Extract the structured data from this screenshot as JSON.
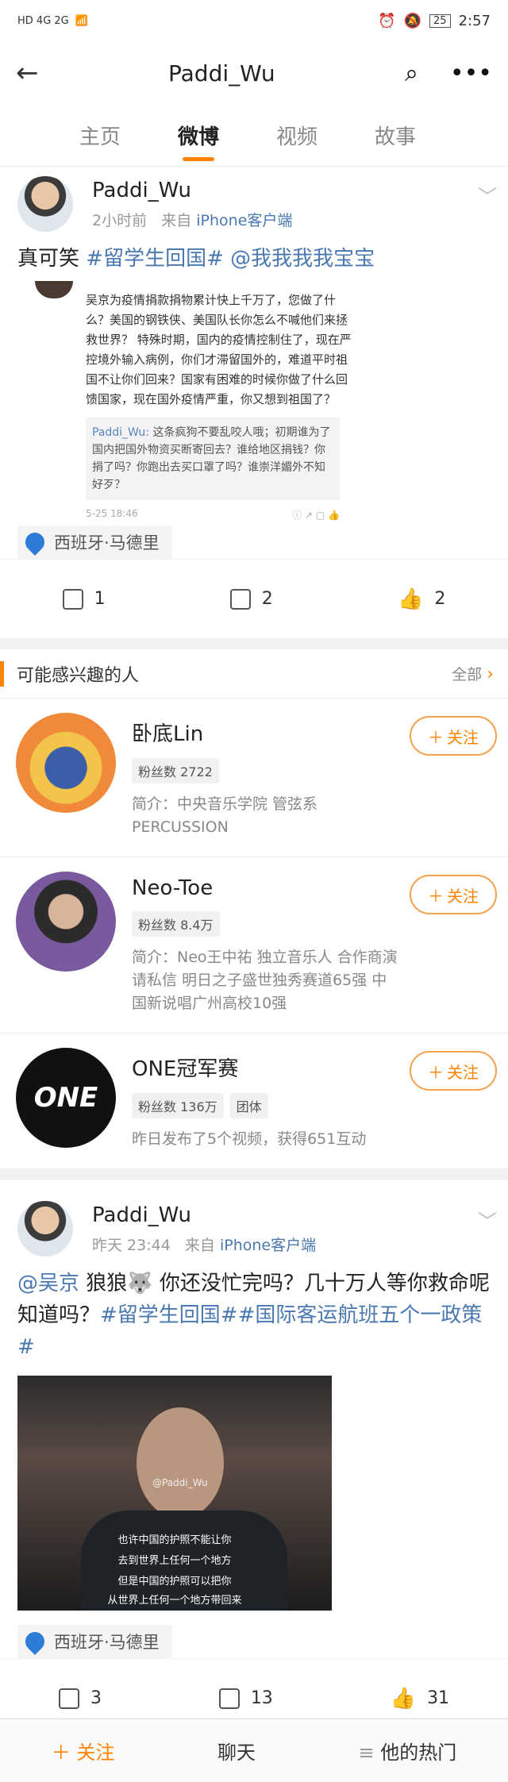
{
  "status": {
    "network": "HD 4G 2G",
    "time": "2:57",
    "battery": "25"
  },
  "topbar": {
    "title": "Paddi_Wu"
  },
  "tabs": [
    "主页",
    "微博",
    "视频",
    "故事"
  ],
  "active_tab": "微博",
  "post1": {
    "author": "Paddi_Wu",
    "time": "2小时前",
    "source_prefix": "来自",
    "source": "iPhone客户端",
    "text_plain": "真可笑",
    "text_tag": "#留学生回国#",
    "text_mention": "@我我我我宝宝",
    "quote_text": "吴京为疫情捐款捐物累计快上千万了，您做了什么？美国的钢铁侠、美国队长你怎么不喊他们来拯救世界？ 特殊时期，国内的疫情控制住了，现在严控境外输入病例，你们才滞留国外的，难道平时祖国不让你们回来？国家有困难的时候你做了什么回馈国家，现在国外疫情严重，你又想到祖国了？",
    "reply_name": "Paddi_Wu:",
    "reply_text": "这条疯狗不要乱咬人哦；初期谁为了国内把国外物资买断寄回去？谁给地区捐钱？你捐了吗？你跑出去买口罩了吗？谁崇洋媚外不知好歹？",
    "quote_date": "5-25 18:46",
    "location": "西班牙·马德里",
    "reposts": "1",
    "comments": "2",
    "likes": "2"
  },
  "suggest": {
    "title": "可能感兴趣的人",
    "all_label": "全部",
    "follow_label": "关注",
    "people": [
      {
        "name": "卧底Lin",
        "fans": "粉丝数 2722",
        "extra_tag": "",
        "desc": "简介：中央音乐学院 管弦系 PERCUSSION"
      },
      {
        "name": "Neo-Toe",
        "fans": "粉丝数 8.4万",
        "extra_tag": "",
        "desc": "简介：Neo王中祐 独立音乐人 合作商演请私信 明日之子盛世独秀赛道65强 中国新说唱广州高校10强"
      },
      {
        "name": "ONE冠军赛",
        "fans": "粉丝数 136万",
        "extra_tag": "团体",
        "desc": "昨日发布了5个视频，获得651互动"
      }
    ]
  },
  "post2": {
    "author": "Paddi_Wu",
    "time": "昨天 23:44",
    "source_prefix": "来自",
    "source": "iPhone客户端",
    "mention": "@吴京",
    "text_a": " 狼狼🐺 你还没忙完吗？几十万人等你救命呢知道吗？",
    "tags": "#留学生回国##国际客运航班五个一政策#",
    "img_watermark": "@Paddi_Wu",
    "img_sub1": "也许中国的护照不能让你",
    "img_sub2": "去到世界上任何一个地方",
    "img_sub3": "但是中国的护照可以把你",
    "img_sub4": "从世界上任何一个地方带回来",
    "location": "西班牙·马德里",
    "reposts": "3",
    "comments": "13",
    "likes": "31"
  },
  "bottom_nav": {
    "follow": "关注",
    "chat": "聊天",
    "hot": "他的热门"
  },
  "colors": {
    "accent": "#ff8200",
    "link": "#4a78b0"
  }
}
